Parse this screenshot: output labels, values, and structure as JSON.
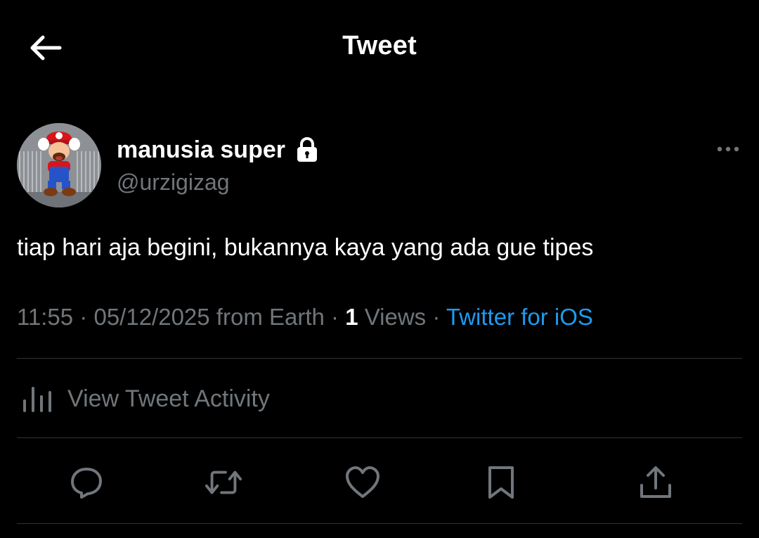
{
  "header": {
    "title": "Tweet",
    "back_icon": "arrow-left-icon"
  },
  "author": {
    "display_name": "manusia super",
    "handle": "@urzigizag",
    "protected_icon": "lock-icon",
    "avatar_description_icon": "avatar-image",
    "more_icon": "more-horizontal-icon"
  },
  "tweet": {
    "text": "tiap hari aja begini, bukannya kaya yang ada gue tipes"
  },
  "meta": {
    "time": "11:55",
    "sep1": " · ",
    "date": "05/12/2025",
    "location": " from Earth",
    "sep2": " · ",
    "views_count": "1",
    "views_label": " Views",
    "sep3": " · ",
    "source": "Twitter for iOS"
  },
  "activity": {
    "label": "View Tweet Activity",
    "icon": "bar-chart-icon"
  },
  "actions": {
    "reply_icon": "reply-icon",
    "retweet_icon": "retweet-icon",
    "like_icon": "heart-icon",
    "bookmark_icon": "bookmark-icon",
    "share_icon": "share-icon"
  },
  "colors": {
    "background": "#000000",
    "primary_text": "#ffffff",
    "secondary_text": "#71767b",
    "link": "#1d9bf0",
    "divider": "#2f3336"
  }
}
